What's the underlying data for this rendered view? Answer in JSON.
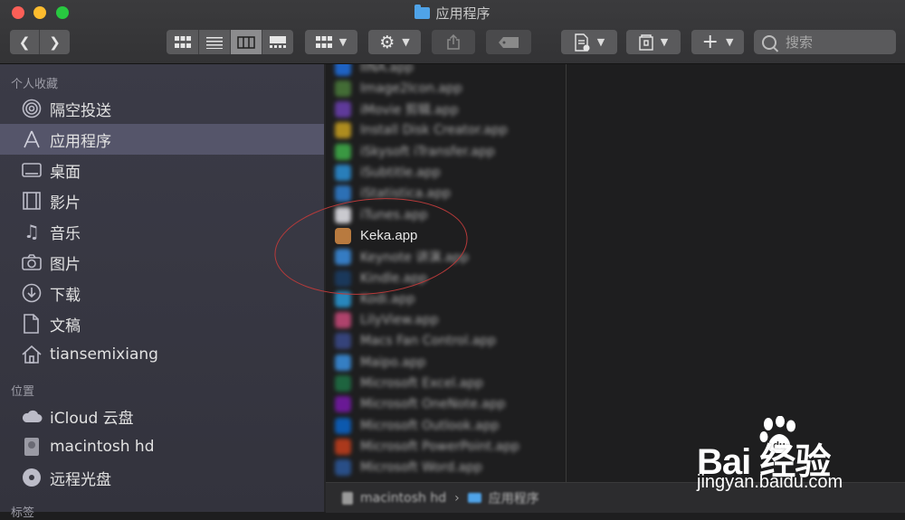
{
  "window": {
    "title": "应用程序",
    "colors": {
      "close": "#fc5f57",
      "minimize": "#fdbc2e",
      "maximize": "#28c840",
      "accent": "#4fa3e8"
    }
  },
  "toolbar": {
    "back_icon": "chevron-left-icon",
    "forward_icon": "chevron-right-icon",
    "view_modes": [
      "icon-view-icon",
      "list-view-icon",
      "column-view-icon",
      "gallery-view-icon"
    ],
    "active_view": "column-view-icon",
    "arrange_icon": "grid-icon",
    "action_icon": "gear-icon",
    "share_icon": "share-icon",
    "tag_icon": "tag-icon",
    "new_doc_icon": "new-document-icon",
    "archive_icon": "archive-icon",
    "add_icon": "plus-icon",
    "search": {
      "placeholder": "搜索",
      "icon": "search-icon"
    }
  },
  "sidebar": {
    "favorites_header": "个人收藏",
    "favorites": [
      {
        "label": "隔空投送",
        "icon": "airdrop-icon"
      },
      {
        "label": "应用程序",
        "icon": "applications-icon",
        "selected": true
      },
      {
        "label": "桌面",
        "icon": "desktop-icon"
      },
      {
        "label": "影片",
        "icon": "movies-icon"
      },
      {
        "label": "音乐",
        "icon": "music-icon"
      },
      {
        "label": "图片",
        "icon": "camera-icon"
      },
      {
        "label": "下载",
        "icon": "download-icon"
      },
      {
        "label": "文稿",
        "icon": "documents-icon"
      },
      {
        "label": "tiansemixiang",
        "icon": "home-icon"
      }
    ],
    "locations_header": "位置",
    "locations": [
      {
        "label": "iCloud 云盘",
        "icon": "cloud-icon"
      },
      {
        "label": "macintosh hd",
        "icon": "disk-icon"
      },
      {
        "label": "远程光盘",
        "icon": "optical-disc-icon"
      }
    ],
    "tags_header": "标签"
  },
  "files": [
    {
      "name": "IINA.app",
      "icon": "iina-icon",
      "color": "#1f6fe0",
      "blurred": true
    },
    {
      "name": "Image2Icon.app",
      "icon": "image2icon-icon",
      "color": "#4a7a3a",
      "blurred": true
    },
    {
      "name": "iMovie 剪辑.app",
      "icon": "star-icon",
      "color": "#6b3fb0",
      "blurred": true
    },
    {
      "name": "Install Disk Creator.app",
      "icon": "install-disk-icon",
      "color": "#c8a020",
      "blurred": true
    },
    {
      "name": "iSkysoft iTransfer.app",
      "icon": "transfer-icon",
      "color": "#3fae49",
      "blurred": true
    },
    {
      "name": "iSubtitle.app",
      "icon": "subtitle-icon",
      "color": "#2b8fd6",
      "blurred": true
    },
    {
      "name": "iStatistica.app",
      "icon": "globe-icon",
      "color": "#2f7fd0",
      "blurred": true
    },
    {
      "name": "iTunes.app",
      "icon": "itunes-icon",
      "color": "#e8e8ee",
      "blurred": true
    },
    {
      "name": "Keka.app",
      "icon": "keka-icon",
      "color": "#b87a3f",
      "blurred": false
    },
    {
      "name": "Keynote 讲演.app",
      "icon": "keynote-icon",
      "color": "#3a8de0",
      "blurred": true
    },
    {
      "name": "Kindle.app",
      "icon": "kindle-icon",
      "color": "#1a3d66",
      "blurred": true
    },
    {
      "name": "Kodi.app",
      "icon": "kodi-icon",
      "color": "#2a9ad8",
      "blurred": true
    },
    {
      "name": "LilyView.app",
      "icon": "lilyview-icon",
      "color": "#c84a7a",
      "blurred": true
    },
    {
      "name": "Macs Fan Control.app",
      "icon": "fan-icon",
      "color": "#3a4a8a",
      "blurred": true
    },
    {
      "name": "Maipo.app",
      "icon": "maipo-icon",
      "color": "#3a90e0",
      "blurred": true
    },
    {
      "name": "Microsoft Excel.app",
      "icon": "excel-icon",
      "color": "#1e7145",
      "blurred": true
    },
    {
      "name": "Microsoft OneNote.app",
      "icon": "onenote-icon",
      "color": "#7719aa",
      "blurred": true
    },
    {
      "name": "Microsoft Outlook.app",
      "icon": "outlook-icon",
      "color": "#0a64c8",
      "blurred": true
    },
    {
      "name": "Microsoft PowerPoint.app",
      "icon": "powerpoint-icon",
      "color": "#c43e1c",
      "blurred": true
    },
    {
      "name": "Microsoft Word.app",
      "icon": "word-icon",
      "color": "#2b579a",
      "blurred": true
    }
  ],
  "pathbar": [
    {
      "label": "macintosh hd",
      "icon": "disk-icon"
    },
    {
      "label": "应用程序",
      "icon": "folder-icon"
    }
  ],
  "watermark": {
    "brand": "Bai  经验",
    "url": "jingyan.baidu.com"
  }
}
